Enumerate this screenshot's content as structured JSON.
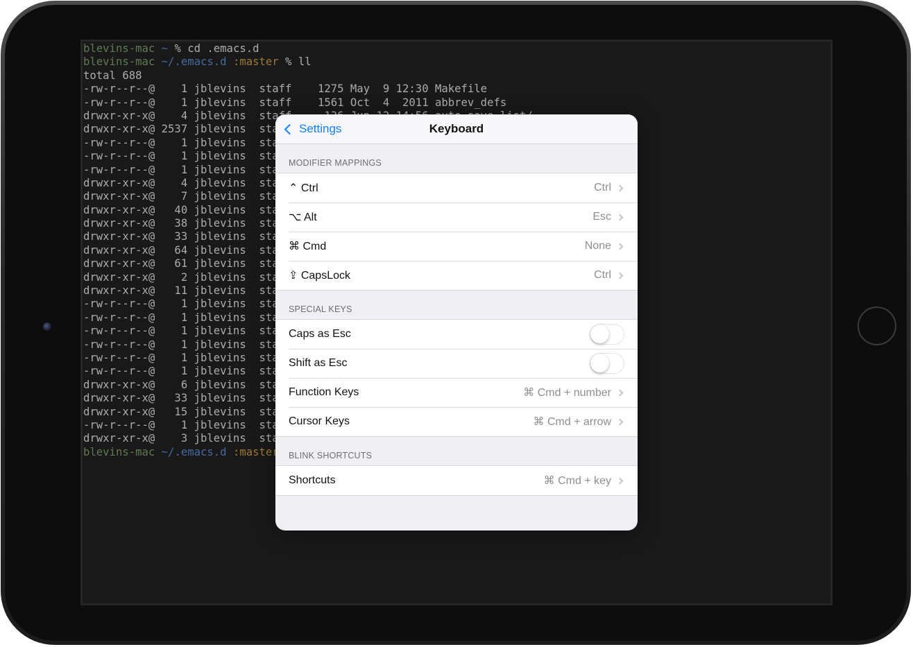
{
  "terminal": {
    "lines": [
      {
        "host": "blevins-mac",
        "path": "~",
        "branch": "",
        "rest": " % cd .emacs.d"
      },
      {
        "host": "blevins-mac",
        "path": "~/.emacs.d",
        "branch": ":master",
        "rest": " % ll"
      },
      {
        "text": "total 688"
      },
      {
        "text": "-rw-r--r--@    1 jblevins  staff    1275 May  9 12:30 Makefile"
      },
      {
        "text": "-rw-r--r--@    1 jblevins  staff    1561 Oct  4  2011 abbrev_defs"
      },
      {
        "text": "drwxr-xr-x@    4 jblevins  staff     136 Jun 12 14:56 auto-save-list/"
      },
      {
        "text": "drwxr-xr-x@ 2537 jblevins  sta"
      },
      {
        "text": "-rw-r--r--@    1 jblevins  sta"
      },
      {
        "text": "-rw-r--r--@    1 jblevins  sta"
      },
      {
        "text": "-rw-r--r--@    1 jblevins  sta"
      },
      {
        "text": "drwxr-xr-x@    4 jblevins  sta"
      },
      {
        "text": "drwxr-xr-x@    7 jblevins  sta"
      },
      {
        "text": "drwxr-xr-x@   40 jblevins  sta"
      },
      {
        "text": "drwxr-xr-x@   38 jblevins  sta"
      },
      {
        "text": "drwxr-xr-x@   33 jblevins  sta"
      },
      {
        "text": "drwxr-xr-x@   64 jblevins  sta"
      },
      {
        "text": "drwxr-xr-x@   61 jblevins  sta"
      },
      {
        "text": "drwxr-xr-x@    2 jblevins  sta"
      },
      {
        "text": "drwxr-xr-x@   11 jblevins  sta"
      },
      {
        "text": "-rw-r--r--@    1 jblevins  sta"
      },
      {
        "text": "-rw-r--r--@    1 jblevins  sta"
      },
      {
        "text": "-rw-r--r--@    1 jblevins  sta"
      },
      {
        "text": "-rw-r--r--@    1 jblevins  sta"
      },
      {
        "text": "-rw-r--r--@    1 jblevins  sta"
      },
      {
        "text": "-rw-r--r--@    1 jblevins  sta"
      },
      {
        "text": "drwxr-xr-x@    6 jblevins  sta"
      },
      {
        "text": "drwxr-xr-x@   33 jblevins  sta"
      },
      {
        "text": "drwxr-xr-x@   15 jblevins  sta"
      },
      {
        "text": "-rw-r--r--@    1 jblevins  sta"
      },
      {
        "text": "drwxr-xr-x@    3 jblevins  sta"
      },
      {
        "host": "blevins-mac",
        "path": "~/.emacs.d",
        "branch": ":master",
        "rest": ""
      }
    ]
  },
  "sheet": {
    "back_label": "Settings",
    "title": "Keyboard",
    "sections": [
      {
        "header": "MODIFIER MAPPINGS",
        "rows": [
          {
            "label": "⌃ Ctrl",
            "value": "Ctrl",
            "kind": "disclosure",
            "name": "row-ctrl"
          },
          {
            "label": "⌥ Alt",
            "value": "Esc",
            "kind": "disclosure",
            "name": "row-alt"
          },
          {
            "label": "⌘ Cmd",
            "value": "None",
            "kind": "disclosure",
            "name": "row-cmd"
          },
          {
            "label": "⇪ CapsLock",
            "value": "Ctrl",
            "kind": "disclosure",
            "name": "row-capslock"
          }
        ]
      },
      {
        "header": "SPECIAL KEYS",
        "rows": [
          {
            "label": "Caps as Esc",
            "value": "",
            "kind": "toggle",
            "on": false,
            "name": "row-caps-as-esc"
          },
          {
            "label": "Shift as Esc",
            "value": "",
            "kind": "toggle",
            "on": false,
            "name": "row-shift-as-esc"
          },
          {
            "label": "Function Keys",
            "value": "⌘ Cmd + number",
            "kind": "disclosure",
            "name": "row-function-keys"
          },
          {
            "label": "Cursor Keys",
            "value": "⌘ Cmd + arrow",
            "kind": "disclosure",
            "name": "row-cursor-keys"
          }
        ]
      },
      {
        "header": "BLINK SHORTCUTS",
        "rows": [
          {
            "label": "Shortcuts",
            "value": "⌘ Cmd + key",
            "kind": "disclosure",
            "name": "row-shortcuts"
          }
        ]
      }
    ]
  }
}
